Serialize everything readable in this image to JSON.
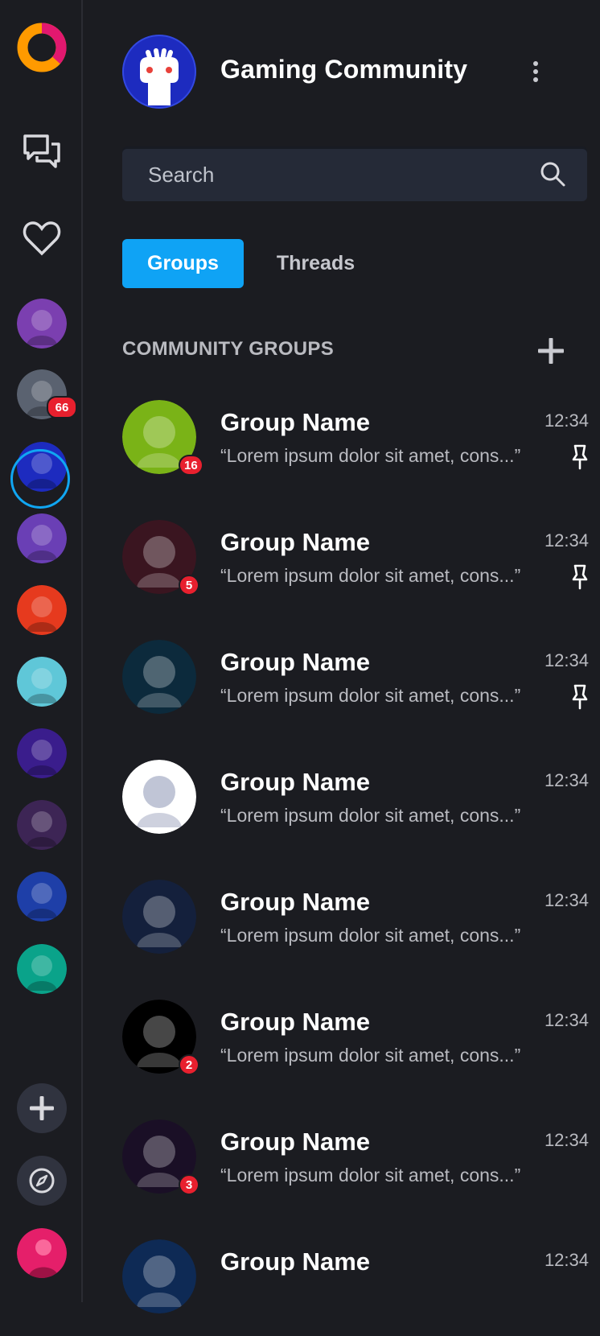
{
  "community": {
    "title": "Gaming Community"
  },
  "search": {
    "placeholder": "Search"
  },
  "tabs": [
    {
      "label": "Groups",
      "active": true
    },
    {
      "label": "Threads",
      "active": false
    }
  ],
  "section": {
    "title": "COMMUNITY GROUPS"
  },
  "rail": {
    "logo_icon": "app-logo-icon",
    "chat_icon": "chat-bubbles-icon",
    "favorites_icon": "heart-icon",
    "servers": [
      {
        "name": "microphone-server",
        "color": "#7b3fb0",
        "badge": ""
      },
      {
        "name": "soldier-server",
        "color": "#5a6270",
        "badge": "66"
      },
      {
        "name": "gaming-community-server",
        "color": "#1d2bbf",
        "badge": "",
        "active": true
      },
      {
        "name": "cyber-skull-server",
        "color": "#6a3fb5",
        "badge": ""
      },
      {
        "name": "foxity-server",
        "color": "#e63a1e",
        "badge": ""
      },
      {
        "name": "robot-gamer-server",
        "color": "#5fc7d8",
        "badge": ""
      },
      {
        "name": "infinity-server",
        "color": "#3a1d8c",
        "badge": ""
      },
      {
        "name": "ethereum-server",
        "color": "#3d2555",
        "badge": ""
      },
      {
        "name": "bitcoin-server",
        "color": "#1e3fa8",
        "badge": ""
      },
      {
        "name": "book-server",
        "color": "#0aa38a",
        "badge": ""
      }
    ],
    "add_icon": "plus-icon",
    "explore_icon": "compass-icon",
    "profile_color": "#e51f6a"
  },
  "groups": [
    {
      "name": "Group Name",
      "time": "12:34",
      "message": "“Lorem ipsum dolor sit amet, cons...”",
      "badge": "16",
      "pinned": true,
      "color": "#7ab317",
      "icon": "knight-icon"
    },
    {
      "name": "Group Name",
      "time": "12:34",
      "message": "“Lorem ipsum dolor sit amet, cons...”",
      "badge": "5",
      "pinned": true,
      "color": "#3a1520",
      "icon": "warrior-icon"
    },
    {
      "name": "Group Name",
      "time": "12:34",
      "message": "“Lorem ipsum dolor sit amet, cons...”",
      "badge": "",
      "pinned": true,
      "color": "#0c2a3c",
      "icon": "wolf-icon"
    },
    {
      "name": "Group Name",
      "time": "12:34",
      "message": "“Lorem ipsum dolor sit amet, cons...”",
      "badge": "",
      "pinned": false,
      "color": "#ffffff",
      "icon": "championship-icon"
    },
    {
      "name": "Group Name",
      "time": "12:34",
      "message": "“Lorem ipsum dolor sit amet, cons...”",
      "badge": "",
      "pinned": false,
      "color": "#14203c",
      "icon": "darth-icon"
    },
    {
      "name": "Group Name",
      "time": "12:34",
      "message": "“Lorem ipsum dolor sit amet, cons...”",
      "badge": "2",
      "pinned": false,
      "color": "#000000",
      "icon": "triangle-logo-icon"
    },
    {
      "name": "Group Name",
      "time": "12:34",
      "message": "“Lorem ipsum dolor sit amet, cons...”",
      "badge": "3",
      "pinned": false,
      "color": "#1a0f26",
      "icon": "hooded-figure-icon"
    },
    {
      "name": "Group Name",
      "time": "12:34",
      "message": "",
      "badge": "",
      "pinned": false,
      "color": "#0e2a55",
      "icon": "monster-icon"
    }
  ]
}
